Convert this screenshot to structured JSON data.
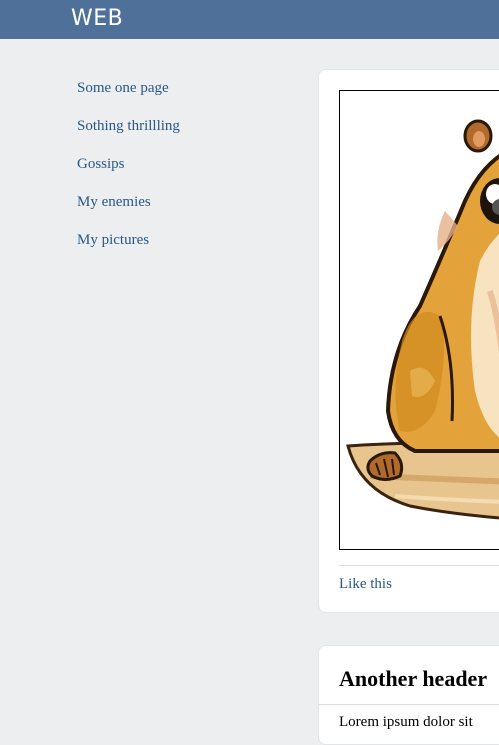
{
  "header": {
    "brand": "WEB"
  },
  "sidebar": {
    "items": [
      {
        "label": "Some one page"
      },
      {
        "label": "Sothing thrillling"
      },
      {
        "label": "Gossips"
      },
      {
        "label": "My enemies"
      },
      {
        "label": "My pictures"
      }
    ]
  },
  "posts": [
    {
      "image_subject": "cartoon-hamster",
      "like_label": "Like this"
    },
    {
      "title": "Another header",
      "body_preview": "Lorem ipsum dolor sit"
    }
  ],
  "colors": {
    "topbar": "#4f7199",
    "link": "#2a5885",
    "background": "#edeef0"
  }
}
